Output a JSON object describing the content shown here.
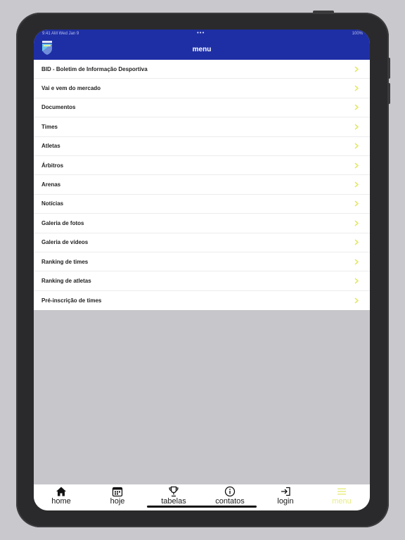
{
  "header": {
    "title": "menu",
    "status_time": "9:41 AM  Wed Jan 9",
    "status_dots": "•••",
    "status_right": "100%"
  },
  "menu": {
    "items": [
      {
        "label": "BID - Boletim de Informação Desportiva"
      },
      {
        "label": "Vai e vem do mercado"
      },
      {
        "label": "Documentos"
      },
      {
        "label": "Times"
      },
      {
        "label": "Atletas"
      },
      {
        "label": "Árbitros"
      },
      {
        "label": "Arenas"
      },
      {
        "label": "Notícias"
      },
      {
        "label": "Galeria de fotos"
      },
      {
        "label": "Galeria de vídeos"
      },
      {
        "label": "Ranking de times"
      },
      {
        "label": "Ranking de atletas"
      },
      {
        "label": "Pré-inscrição de times"
      }
    ]
  },
  "tabs": [
    {
      "label": "home",
      "icon": "house-icon"
    },
    {
      "label": "hoje",
      "icon": "calendar-icon"
    },
    {
      "label": "tabelas",
      "icon": "trophy-icon"
    },
    {
      "label": "contatos",
      "icon": "info-icon"
    },
    {
      "label": "login",
      "icon": "login-icon"
    },
    {
      "label": "menu",
      "icon": "menu-icon",
      "active": true
    }
  ],
  "colors": {
    "header": "#1e2fa5",
    "accent": "#e8ee84",
    "chevron": "#e2e862"
  }
}
